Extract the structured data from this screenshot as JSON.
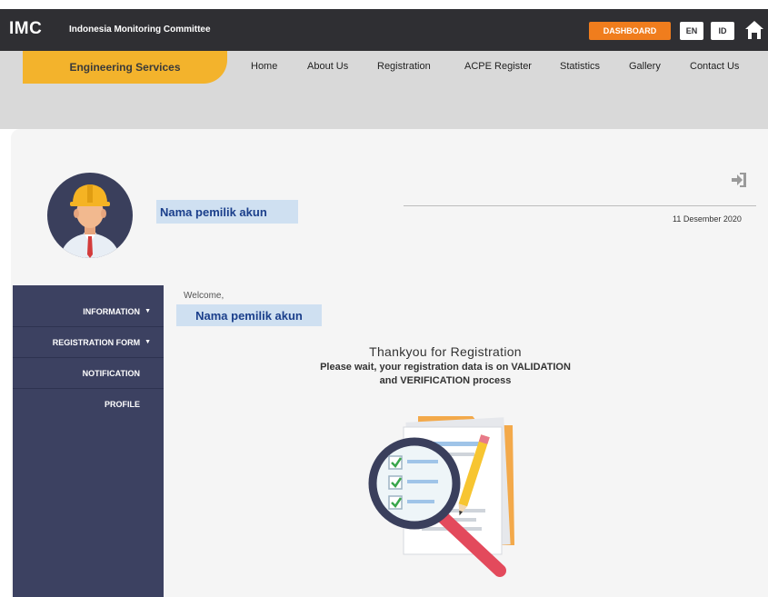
{
  "header": {
    "brand": "IMC",
    "brand_subtitle": "Indonesia Monitoring Committee",
    "dashboard_label": "DASHBOARD",
    "lang_en": "EN",
    "lang_id": "ID",
    "home_icon": "home-icon"
  },
  "nav": {
    "section_label": "Engineering Services",
    "items": [
      {
        "label": "Home"
      },
      {
        "label": "About Us"
      },
      {
        "label": "Registration"
      },
      {
        "label": "ACPE Register"
      },
      {
        "label": "Statistics"
      },
      {
        "label": "Gallery"
      },
      {
        "label": "Contact Us"
      }
    ]
  },
  "profile": {
    "name": "Nama pemilik akun",
    "date": "11 Desember 2020",
    "logout_icon": "logout-icon",
    "avatar_icon": "engineer-avatar-icon"
  },
  "sidebar": {
    "items": [
      {
        "label": "INFORMATION",
        "has_caret": true
      },
      {
        "label": "REGISTRATION FORM",
        "has_caret": true
      },
      {
        "label": "NOTIFICATION",
        "has_caret": false
      },
      {
        "label": "PROFILE",
        "has_caret": false
      }
    ]
  },
  "main": {
    "welcome": "Welcome,",
    "user_name": "Nama pemilik akun",
    "thanks_title": "Thankyou for Registration",
    "wait_line1": "Please wait, your registration data is on VALIDATION",
    "wait_line2": "and VERIFICATION process",
    "illustration_icon": "document-magnifier-icon"
  },
  "colors": {
    "topbar": "#2f2f33",
    "accent_orange": "#f07d1d",
    "accent_yellow": "#f3b32c",
    "sidebar": "#3c4161",
    "name_highlight": "#cfe0f1"
  }
}
